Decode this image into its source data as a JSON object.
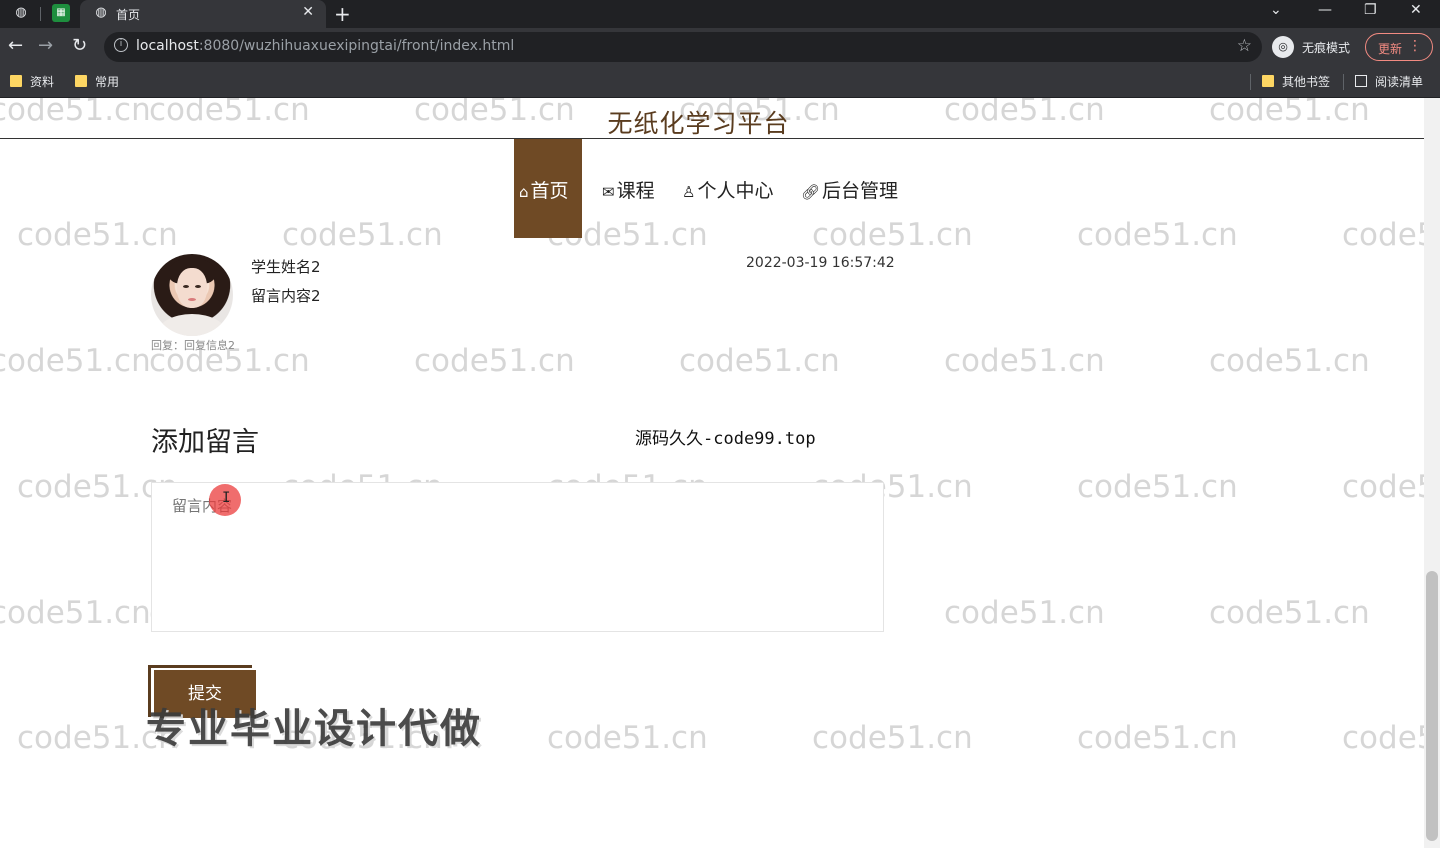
{
  "browser": {
    "tab_title": "首页",
    "tab_close": "✕",
    "new_tab": "+",
    "url_host": "localhost",
    "url_rest": ":8080/wuzhihuaxuexipingtai/front/index.html",
    "incognito_label": "无痕模式",
    "update_label": "更新",
    "bookmarks": [
      "资料",
      "常用"
    ],
    "bookmarks_right": [
      "其他书签",
      "阅读清单"
    ],
    "icons": [
      "globe-icon",
      "sheets-icon",
      "back-arrow-icon",
      "forward-arrow-icon",
      "reload-icon",
      "info-icon",
      "star-icon",
      "incognito-icon",
      "kebab-menu-icon",
      "folder-icon",
      "reading-list-icon",
      "minimize-icon",
      "maximize-icon",
      "close-icon",
      "tab-search-icon"
    ]
  },
  "site": {
    "title": "无纸化学习平台",
    "nav": [
      {
        "label": "首页",
        "icon": "home-icon"
      },
      {
        "label": "课程",
        "icon": "mail-icon"
      },
      {
        "label": "个人中心",
        "icon": "user-icon"
      },
      {
        "label": "后台管理",
        "icon": "link-icon"
      }
    ],
    "accent_color": "#6f4a25"
  },
  "message": {
    "name": "学生姓名2",
    "content": "留言内容2",
    "time": "2022-03-19 16:57:42",
    "reply": "回复：回复信息2"
  },
  "add_message": {
    "title": "添加留言",
    "placeholder": "留言内容",
    "submit_label": "提交"
  },
  "overlays": {
    "source_tag": "源码久久-code99.top",
    "ad_text": "专业毕业设计代做",
    "watermark": "code51.cn"
  }
}
